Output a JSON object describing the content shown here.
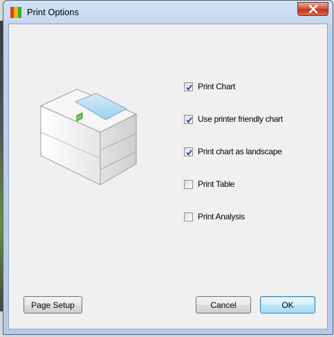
{
  "window": {
    "title": "Print Options",
    "close_glyph": "X",
    "icon": "app-color-bars-icon"
  },
  "illustration": {
    "icon": "printer-icon"
  },
  "options": [
    {
      "label": "Print Chart",
      "checked": true
    },
    {
      "label": "Use printer friendly chart",
      "checked": true
    },
    {
      "label": "Print chart as landscape",
      "checked": true
    },
    {
      "label": "Print Table",
      "checked": false
    },
    {
      "label": "Print Analysis",
      "checked": false
    }
  ],
  "buttons": {
    "page_setup": "Page Setup",
    "cancel": "Cancel",
    "ok": "OK"
  },
  "colors": {
    "accent": "#3c7fb1",
    "close_red": "#c0351b"
  }
}
